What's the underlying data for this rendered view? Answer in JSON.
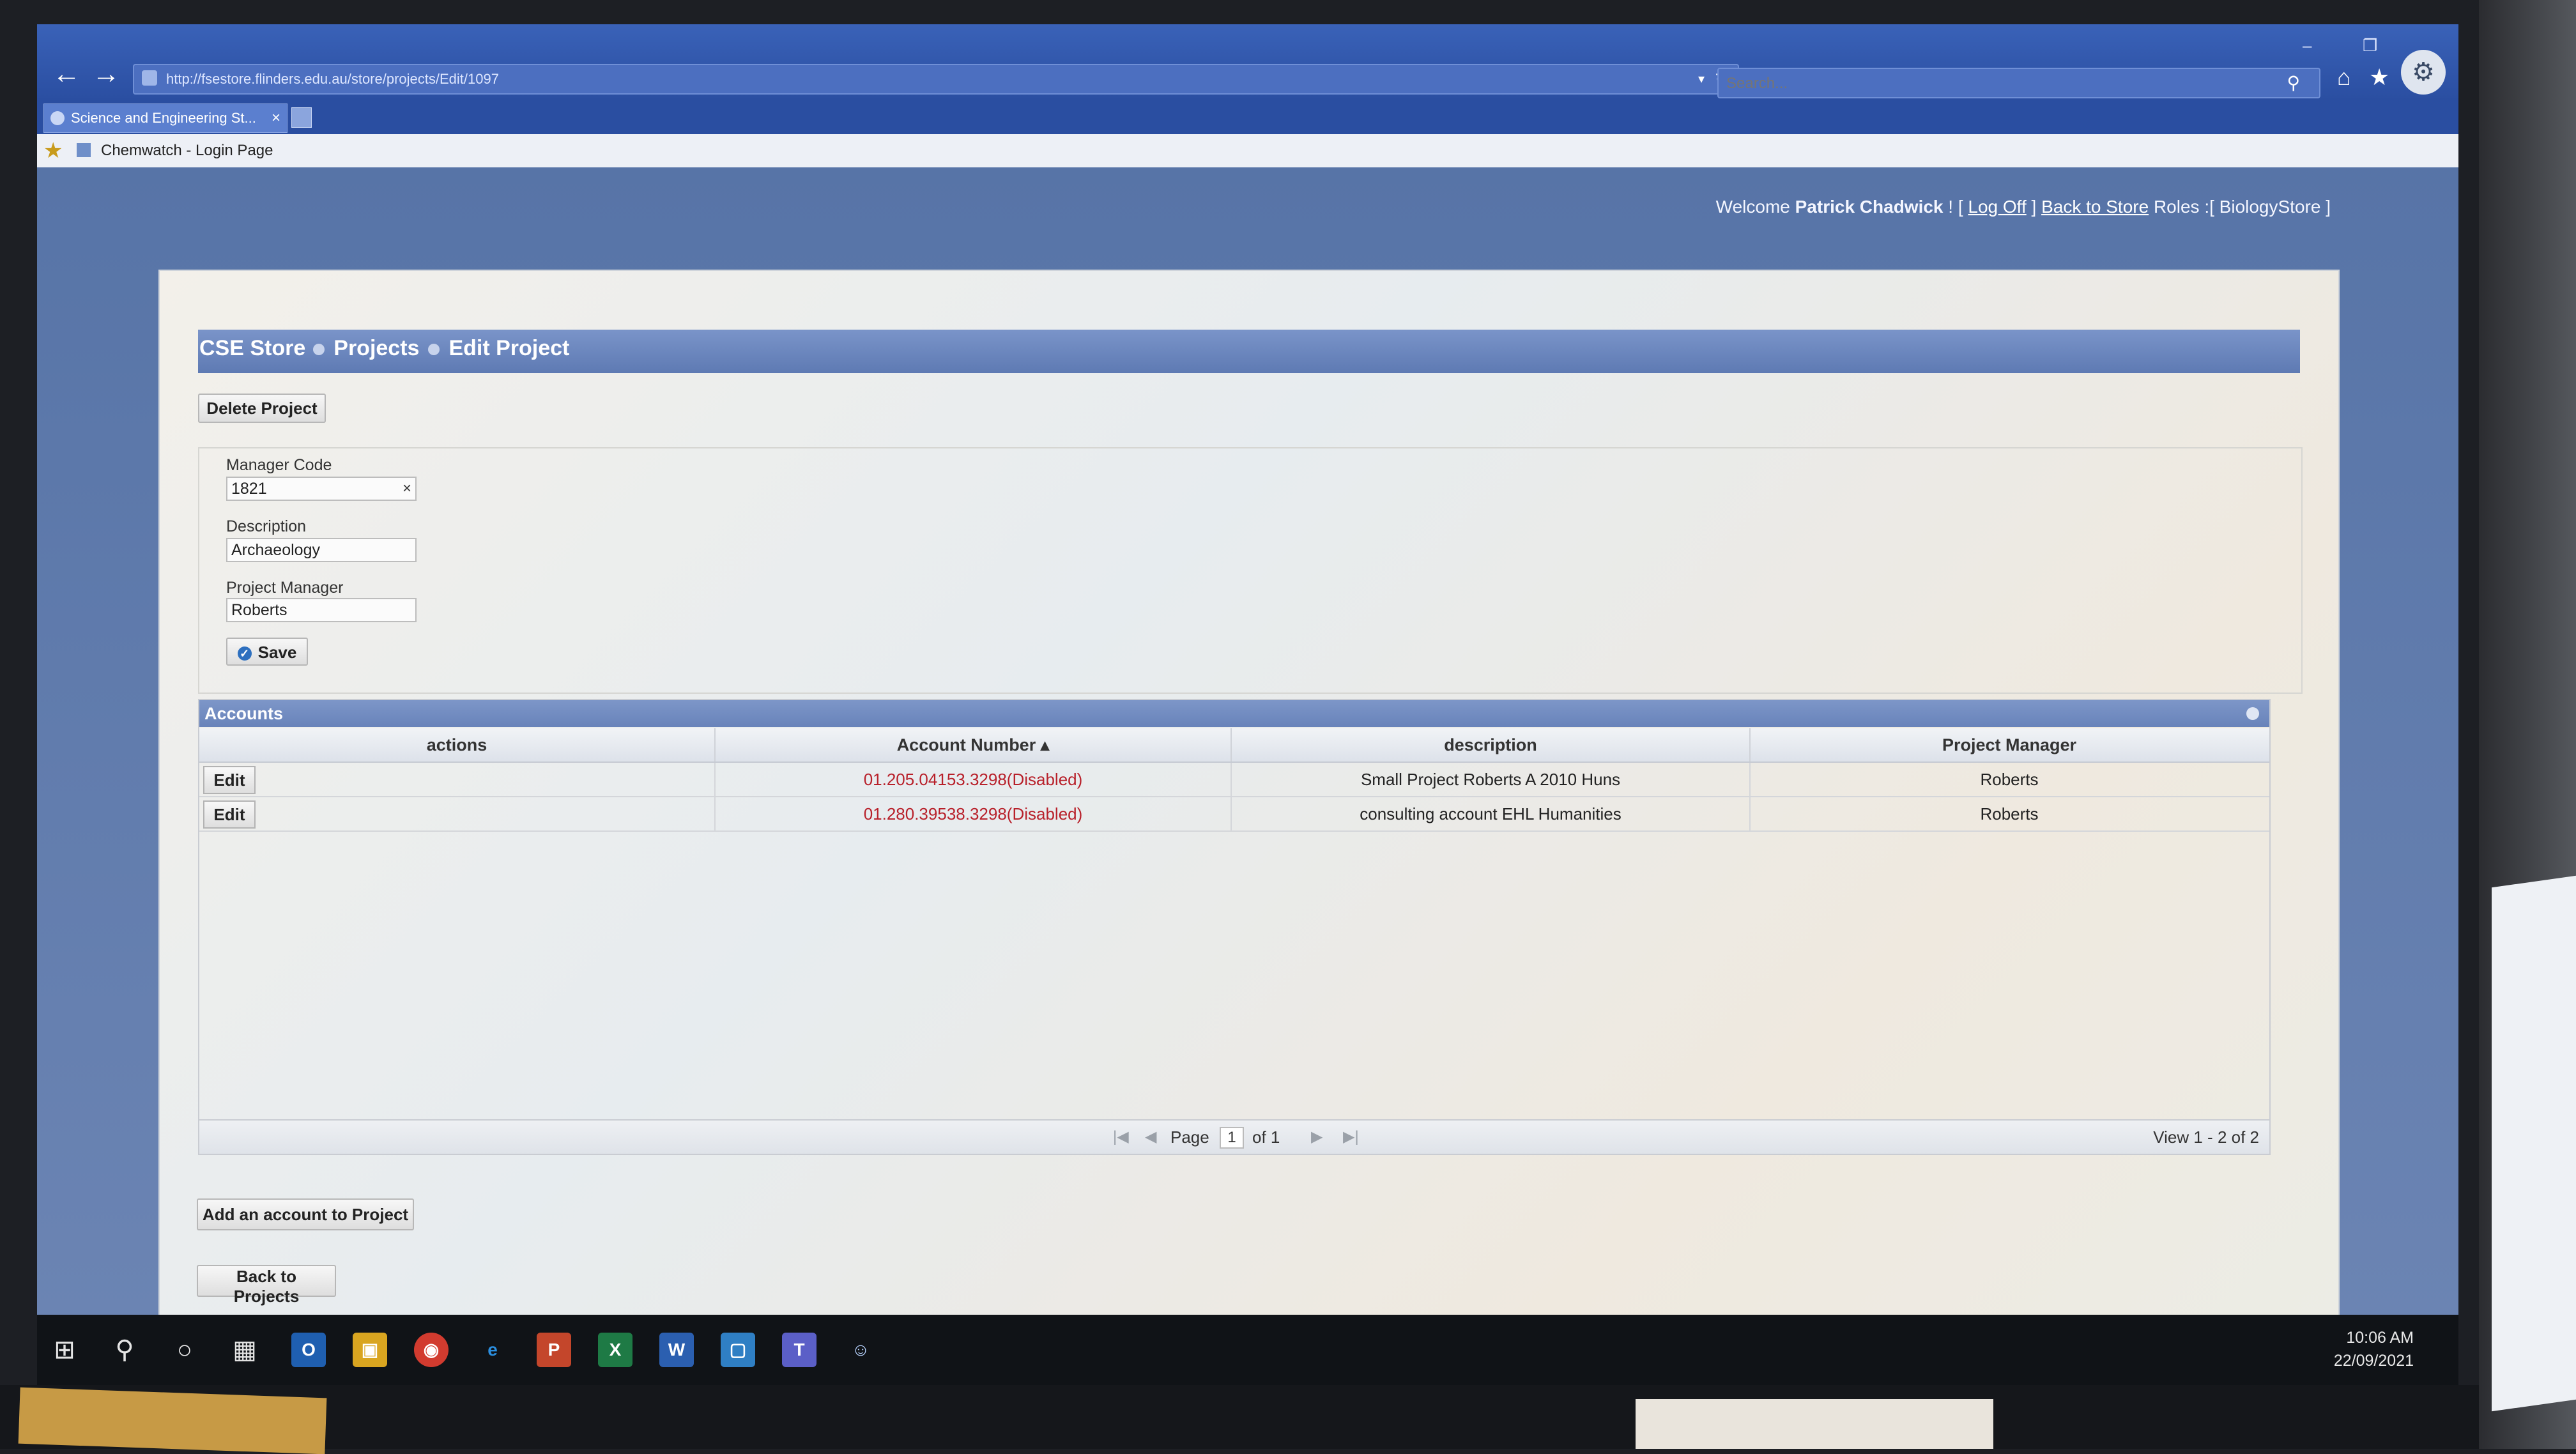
{
  "browser": {
    "url": "http://fsestore.flinders.edu.au/store/projects/Edit/1097",
    "search_placeholder": "Search...",
    "tab_title": "Science and Engineering St...",
    "favorite_label": "Chemwatch - Login Page"
  },
  "header": {
    "welcome_prefix": "Welcome",
    "user_name": "Patrick Chadwick",
    "sep1": "! [",
    "log_off": "Log Off",
    "sep2": "]",
    "back_to_store": "Back to Store",
    "roles_prefix": "Roles :[",
    "role": "BiologyStore",
    "roles_suffix": "]"
  },
  "breadcrumb": {
    "items": [
      "CSE Store",
      "Projects",
      "Edit Project"
    ]
  },
  "actions": {
    "delete_label": "Delete Project",
    "save_label": "Save",
    "add_account_label": "Add an account to Project",
    "back_label": "Back to Projects"
  },
  "form": {
    "manager_code": {
      "label": "Manager Code",
      "value": "1821"
    },
    "description": {
      "label": "Description",
      "value": "Archaeology"
    },
    "project_manager": {
      "label": "Project Manager",
      "value": "Roberts"
    }
  },
  "accounts": {
    "caption": "Accounts",
    "columns": [
      "actions",
      "Account Number",
      "description",
      "Project Manager"
    ],
    "sort_indicator": "▴",
    "rows": [
      {
        "action": "Edit",
        "account": "01.205.04153.3298(Disabled)",
        "description": "Small Project Roberts A 2010 Huns",
        "manager": "Roberts"
      },
      {
        "action": "Edit",
        "account": "01.280.39538.3298(Disabled)",
        "description": "consulting account EHL Humanities",
        "manager": "Roberts"
      }
    ],
    "pager": {
      "page_label": "Page",
      "page_value": "1",
      "of_label": "of 1",
      "view_label": "View 1 - 2 of 2"
    }
  },
  "taskbar": {
    "time": "10:06 AM",
    "date": "22/09/2021"
  }
}
